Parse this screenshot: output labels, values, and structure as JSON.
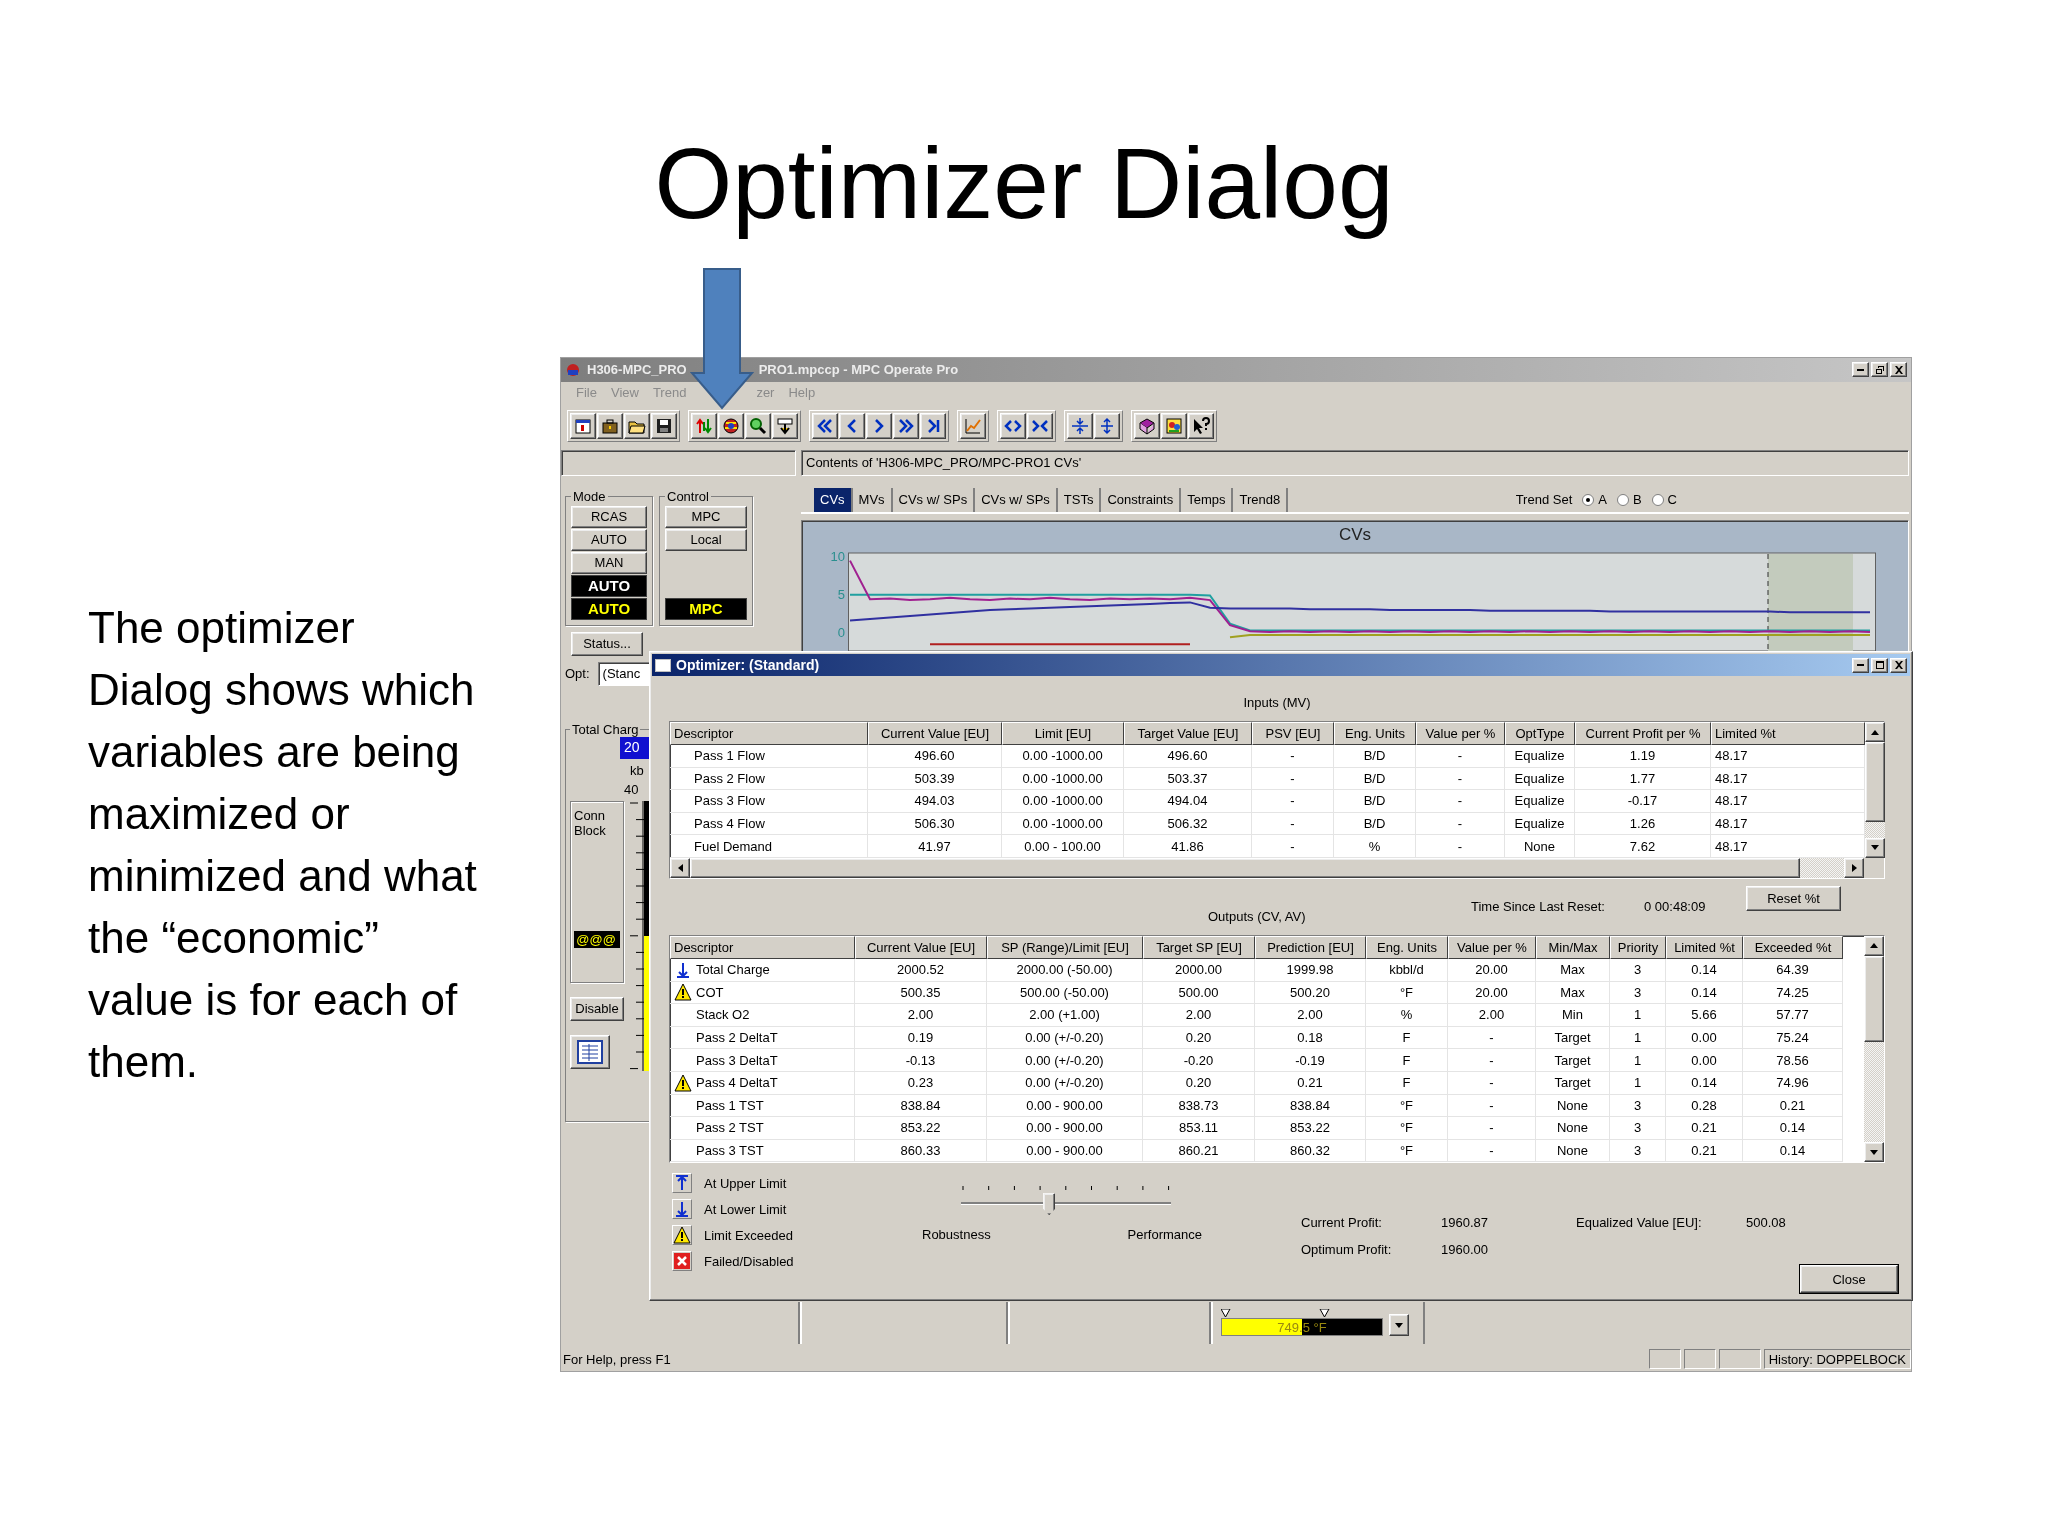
{
  "slide": {
    "title": "Optimizer Dialog",
    "body": "The optimizer Dialog shows which variables are being maximized or minimized and what the “economic” value is for each of them."
  },
  "window": {
    "title_parts": [
      "H306-MPC_PRO",
      "PRO1.mpccp - MPC Operate Pro"
    ],
    "menu": [
      "File",
      "View",
      "Trend",
      "zer",
      "Help"
    ],
    "contents": "Contents of 'H306-MPC_PRO/MPC-PRO1 CVs'"
  },
  "tabs": [
    {
      "label": "CVs",
      "selected": true
    },
    {
      "label": "MVs",
      "selected": false
    },
    {
      "label": "CVs w/ SPs",
      "selected": false
    },
    {
      "label": "CVs w/ SPs",
      "selected": false
    },
    {
      "label": "TSTs",
      "selected": false
    },
    {
      "label": "Constraints",
      "selected": false
    },
    {
      "label": "Temps",
      "selected": false
    },
    {
      "label": "Trend8",
      "selected": false
    }
  ],
  "trend_set": {
    "label": "Trend Set",
    "options": [
      {
        "label": "A",
        "selected": true
      },
      {
        "label": "B",
        "selected": false
      },
      {
        "label": "C",
        "selected": false
      }
    ]
  },
  "trend": {
    "chart_data": {
      "type": "line",
      "title": "CVs",
      "ylim": [
        -2.4,
        10.5
      ],
      "yticks": [
        10,
        5,
        0
      ],
      "series": [
        {
          "color": "#20a0a0",
          "values": [
            5,
            5,
            5,
            5,
            5,
            5,
            5,
            5,
            5,
            5,
            5,
            5,
            5,
            5,
            5,
            5,
            5,
            5,
            4.9,
            1.2,
            0.3,
            0.3,
            0.3,
            0.3,
            0.3,
            0.3,
            0.3,
            0.3,
            0.3,
            0.3,
            0.3,
            0.3,
            0.3,
            0.3,
            0.3,
            0.3,
            0.3,
            0.3,
            0.3,
            0.3,
            0.3,
            0.3,
            0.3,
            0.3,
            0.3,
            0.3,
            0.3,
            0.3,
            0.3,
            0.3,
            0.3,
            0.3
          ]
        },
        {
          "color": "#a02090",
          "values": [
            9.5,
            4.4,
            4.5,
            4.3,
            4.4,
            4.6,
            4.4,
            4.3,
            4.5,
            4.4,
            4.6,
            4.4,
            4.3,
            4.5,
            4.4,
            4.5,
            4.4,
            4.6,
            4.3,
            1.0,
            0.2,
            0.1,
            0.2,
            0.1,
            0.2,
            0.1,
            0.2,
            0.1,
            0.2,
            0.1,
            0.2,
            0.1,
            0.2,
            0.1,
            0.2,
            0.1,
            0.2,
            0.1,
            0.2,
            0.1,
            0.2,
            0.1,
            0.2,
            0.1,
            0.2,
            0.1,
            0.2,
            0.1,
            0.2,
            0.1,
            0.2,
            0.1
          ]
        },
        {
          "color": "#3030a0",
          "values": [
            1.6,
            1.8,
            2.0,
            2.2,
            2.4,
            2.6,
            2.8,
            3.0,
            3.1,
            3.2,
            3.3,
            3.4,
            3.5,
            3.6,
            3.7,
            3.8,
            3.9,
            4.0,
            3.3,
            3.2,
            3.2,
            3.2,
            3.2,
            3.1,
            3.1,
            3.1,
            3.1,
            3.0,
            3.0,
            3.0,
            3.0,
            3.0,
            2.9,
            2.9,
            2.9,
            2.9,
            2.9,
            2.9,
            2.8,
            2.8,
            2.8,
            2.8,
            2.8,
            2.8,
            2.8,
            2.8,
            2.8,
            2.7,
            2.7,
            2.7,
            2.7,
            2.7
          ]
        },
        {
          "color": "#a0a020",
          "values": [
            null,
            null,
            null,
            null,
            null,
            null,
            null,
            null,
            null,
            null,
            null,
            null,
            null,
            null,
            null,
            null,
            null,
            null,
            null,
            -0.6,
            -0.3,
            -0.3,
            -0.3,
            -0.3,
            -0.3,
            -0.3,
            -0.3,
            -0.3,
            -0.3,
            -0.3,
            -0.3,
            -0.3,
            -0.3,
            -0.3,
            -0.3,
            -0.3,
            -0.3,
            -0.3,
            -0.3,
            -0.3,
            -0.3,
            -0.3,
            -0.3,
            -0.3,
            -0.3,
            -0.3,
            -0.3,
            -0.3,
            -0.3,
            -0.3,
            -0.3,
            -0.3
          ]
        },
        {
          "color": "#b02020",
          "values": [
            null,
            null,
            null,
            null,
            -1.5,
            -1.5,
            -1.5,
            -1.5,
            -1.5,
            -1.5,
            -1.5,
            -1.5,
            -1.5,
            -1.5,
            -1.5,
            -1.5,
            -1.5,
            -1.5,
            null,
            null,
            null,
            null,
            null,
            null,
            null,
            null,
            null,
            null,
            null,
            null,
            null,
            null,
            null,
            null,
            null,
            null,
            null,
            null,
            null,
            null,
            null,
            null,
            null,
            null,
            null,
            null,
            null,
            null,
            null,
            null,
            null,
            null
          ]
        }
      ]
    }
  },
  "mode": {
    "label": "Mode",
    "items": [
      {
        "label": "RCAS",
        "kind": "button"
      },
      {
        "label": "AUTO",
        "kind": "button"
      },
      {
        "label": "MAN",
        "kind": "button"
      },
      {
        "label": "AUTO",
        "kind": "actual"
      },
      {
        "label": "AUTO",
        "kind": "target"
      }
    ]
  },
  "control": {
    "label": "Control",
    "items": [
      {
        "label": "MPC",
        "kind": "button"
      },
      {
        "label": "Local",
        "kind": "button"
      },
      {
        "label": "MPC",
        "kind": "target"
      }
    ]
  },
  "status_button": "Status...",
  "opt": {
    "label": "Opt:",
    "value": "(Stanc"
  },
  "total_charge": {
    "label": "Total Charg",
    "value": "20",
    "unit": "kb",
    "scale_label": "40",
    "conn_block": "Conn Block",
    "tag": "@@@",
    "level": 0.5,
    "disable": "Disable"
  },
  "optimizer": {
    "title": "Optimizer: (Standard)",
    "inputs": {
      "label": "Inputs (MV)",
      "columns": [
        "Descriptor",
        "Current Value [EU]",
        "Limit [EU]",
        "Target Value [EU]",
        "PSV [EU]",
        "Eng. Units",
        "Value per %",
        "OptType",
        "Current Profit per %",
        "Limited %t"
      ],
      "rows": [
        [
          "Pass 1 Flow",
          "496.60",
          "0.00 -1000.00",
          "496.60",
          "-",
          "B/D",
          "-",
          "Equalize",
          "1.19",
          "48.17"
        ],
        [
          "Pass 2 Flow",
          "503.39",
          "0.00 -1000.00",
          "503.37",
          "-",
          "B/D",
          "-",
          "Equalize",
          "1.77",
          "48.17"
        ],
        [
          "Pass 3 Flow",
          "494.03",
          "0.00 -1000.00",
          "494.04",
          "-",
          "B/D",
          "-",
          "Equalize",
          "-0.17",
          "48.17"
        ],
        [
          "Pass 4 Flow",
          "506.30",
          "0.00 -1000.00",
          "506.32",
          "-",
          "B/D",
          "-",
          "Equalize",
          "1.26",
          "48.17"
        ],
        [
          "Fuel Demand",
          "41.97",
          "0.00 - 100.00",
          "41.86",
          "-",
          "%",
          "-",
          "None",
          "7.62",
          "48.17"
        ]
      ]
    },
    "outputs": {
      "label": "Outputs (CV, AV)",
      "reset_label": "Time Since Last Reset:",
      "reset_time": "0 00:48:09",
      "reset_button": "Reset %t",
      "columns": [
        "Descriptor",
        "Current Value [EU]",
        "SP (Range)/Limit [EU]",
        "Target SP [EU]",
        "Prediction [EU]",
        "Eng. Units",
        "Value per %",
        "Min/Max",
        "Priority",
        "Limited %t",
        "Exceeded %t"
      ],
      "rows": [
        {
          "kind": "lower",
          "cells": [
            "Total Charge",
            "2000.52",
            "2000.00 (-50.00)",
            "2000.00",
            "1999.98",
            "kbbl/d",
            "20.00",
            "Max",
            "3",
            "0.14",
            "64.39"
          ]
        },
        {
          "kind": "exceeded",
          "cells": [
            "COT",
            "500.35",
            "500.00 (-50.00)",
            "500.00",
            "500.20",
            "°F",
            "20.00",
            "Max",
            "3",
            "0.14",
            "74.25"
          ]
        },
        {
          "kind": "plain",
          "cells": [
            "Stack O2",
            "2.00",
            "2.00 (+1.00)",
            "2.00",
            "2.00",
            "%",
            "2.00",
            "Min",
            "1",
            "5.66",
            "57.77"
          ]
        },
        {
          "kind": "plain",
          "cells": [
            "Pass 2 DeltaT",
            "0.19",
            "0.00 (+/-0.20)",
            "0.20",
            "0.18",
            "F",
            "-",
            "Target",
            "1",
            "0.00",
            "75.24"
          ]
        },
        {
          "kind": "plain",
          "cells": [
            "Pass 3 DeltaT",
            "-0.13",
            "0.00 (+/-0.20)",
            "-0.20",
            "-0.19",
            "F",
            "-",
            "Target",
            "1",
            "0.00",
            "78.56"
          ]
        },
        {
          "kind": "exceeded",
          "cells": [
            "Pass 4 DeltaT",
            "0.23",
            "0.00 (+/-0.20)",
            "0.20",
            "0.21",
            "F",
            "-",
            "Target",
            "1",
            "0.14",
            "74.96"
          ]
        },
        {
          "kind": "plain",
          "cells": [
            "Pass 1 TST",
            "838.84",
            "0.00 - 900.00",
            "838.73",
            "838.84",
            "°F",
            "-",
            "None",
            "3",
            "0.28",
            "0.21"
          ]
        },
        {
          "kind": "plain",
          "cells": [
            "Pass 2 TST",
            "853.22",
            "0.00 - 900.00",
            "853.11",
            "853.22",
            "°F",
            "-",
            "None",
            "3",
            "0.21",
            "0.14"
          ]
        },
        {
          "kind": "plain",
          "cells": [
            "Pass 3 TST",
            "860.33",
            "0.00 - 900.00",
            "860.21",
            "860.32",
            "°F",
            "-",
            "None",
            "3",
            "0.21",
            "0.14"
          ]
        }
      ]
    },
    "legend": [
      {
        "kind": "upper",
        "label": "At Upper Limit"
      },
      {
        "kind": "lower",
        "label": "At Lower Limit"
      },
      {
        "kind": "exceeded",
        "label": "Limit Exceeded"
      },
      {
        "kind": "failed",
        "label": "Failed/Disabled"
      }
    ],
    "slider": {
      "level": 0.42,
      "left_label": "Robustness",
      "right_label": "Performance"
    },
    "profits": [
      {
        "label": "Current Profit:",
        "value": "1960.87"
      },
      {
        "label": "Optimum Profit:",
        "value": "1960.00"
      }
    ],
    "equalized": {
      "label": "Equalized Value [EU]:",
      "value": "500.08"
    },
    "close": "Close"
  },
  "bottom_meter": {
    "reading": "749.5 °F",
    "level": 0.5
  },
  "status_bar": {
    "help": "For Help, press F1",
    "history": "History: DOPPELBOCK"
  }
}
